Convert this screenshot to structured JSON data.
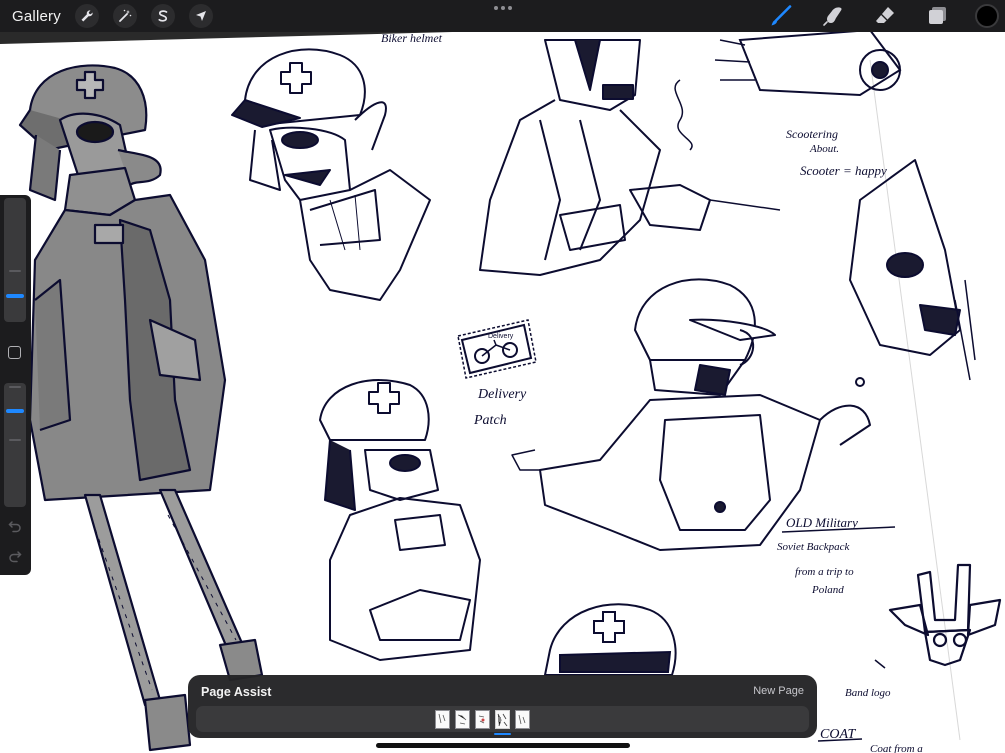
{
  "toolbar": {
    "gallery_label": "Gallery",
    "left_tools": [
      {
        "name": "actions",
        "icon": "wrench-icon"
      },
      {
        "name": "adjustments",
        "icon": "magic-wand-icon"
      },
      {
        "name": "selection",
        "icon": "selection-s-icon"
      },
      {
        "name": "transform",
        "icon": "arrow-cursor-icon"
      }
    ],
    "more_icon": "more-dots-icon",
    "right_tools": [
      {
        "name": "brush",
        "icon": "brush-icon",
        "active": true
      },
      {
        "name": "smudge",
        "icon": "smudge-icon"
      },
      {
        "name": "eraser",
        "icon": "eraser-icon"
      },
      {
        "name": "layers",
        "icon": "layers-icon"
      }
    ],
    "current_color": "#000000",
    "accent_color": "#1e88ff"
  },
  "sidebar": {
    "brush_size_icon": "brush-size-slider",
    "opacity_icon": "opacity-slider",
    "modify_icon": "square-modify-icon",
    "undo_icon": "undo-icon",
    "redo_icon": "redo-icon"
  },
  "canvas": {
    "annotations": {
      "biker_helmet": "Biker helmet",
      "scootering_1": "Scootering",
      "scootering_2": "About.",
      "scooter_happy": "Scooter = happy",
      "delivery_1": "Delivery",
      "delivery_2": "Patch",
      "patch_text": "Delivery",
      "military_1": "OLD Military",
      "military_2": "Soviet Backpack",
      "military_3": "from a trip to",
      "military_4": "Poland",
      "band_logo": "Band logo",
      "coat": "COAT",
      "coat_2": "Coat from a"
    }
  },
  "page_assist": {
    "title": "Page Assist",
    "new_page_label": "New Page",
    "pages": [
      1,
      2,
      3,
      4,
      5
    ],
    "active_page": 4
  }
}
